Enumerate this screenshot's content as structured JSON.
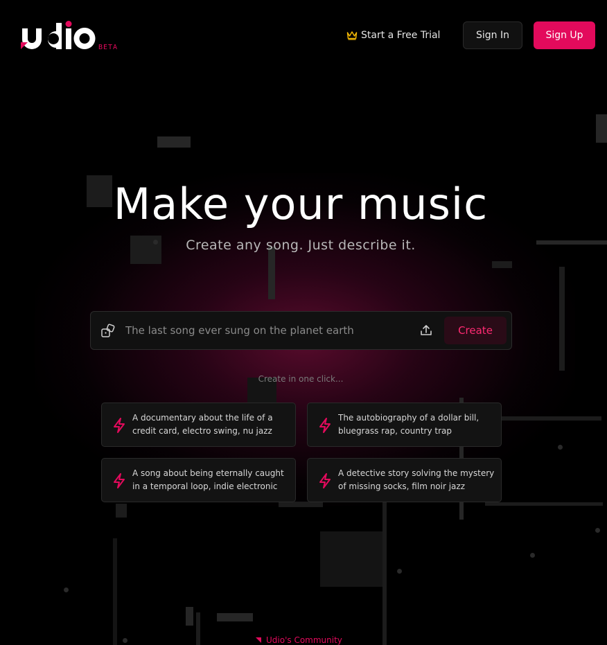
{
  "header": {
    "logo_text": "udio",
    "logo_badge": "BETA",
    "trial_label": "Start a Free Trial",
    "sign_in_label": "Sign In",
    "sign_up_label": "Sign Up"
  },
  "hero": {
    "title": "Make your music",
    "subtitle": "Create any song. Just describe it."
  },
  "prompt": {
    "placeholder": "The last song ever sung on the planet earth",
    "create_label": "Create"
  },
  "suggestions": {
    "heading": "Create in one click...",
    "items": [
      {
        "text": "A documentary about the life of a credit card, electro swing, nu jazz"
      },
      {
        "text": "The autobiography of a dollar bill, bluegrass rap, country trap"
      },
      {
        "text": "A song about being eternally caught in a temporal loop, indie electronic"
      },
      {
        "text": "A detective story solving the mystery of missing socks, film noir jazz"
      }
    ]
  },
  "footer": {
    "community_label": "Udio's Community"
  },
  "colors": {
    "accent": "#e30a5c",
    "background": "#000000",
    "card": "#131313",
    "crown": "#f2b705"
  },
  "icons": {
    "trial": "crown-icon",
    "prompt_left": "dice-icon",
    "prompt_right": "upload-icon",
    "card": "lightning-bolt-icon",
    "community": "triangle-flag-icon"
  }
}
